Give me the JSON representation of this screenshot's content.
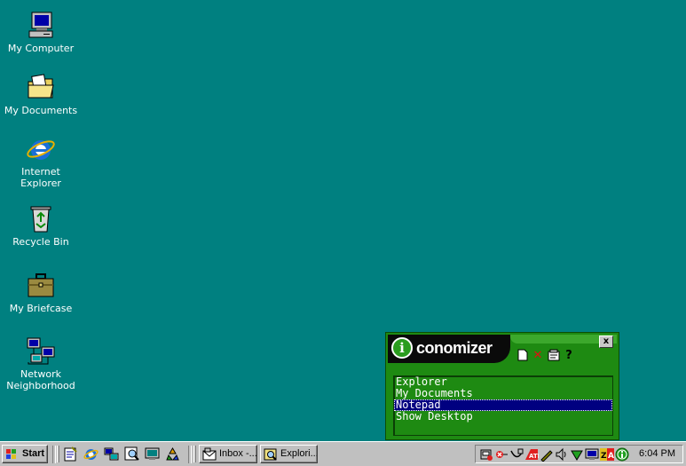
{
  "desktop": {
    "icons": [
      {
        "label": "My Computer",
        "icon": "my-computer-icon"
      },
      {
        "label": "My Documents",
        "icon": "my-documents-folder-icon"
      },
      {
        "label": "Internet Explorer",
        "icon": "internet-explorer-icon"
      },
      {
        "label": "Recycle Bin",
        "icon": "recycle-bin-icon"
      },
      {
        "label": "My Briefcase",
        "icon": "briefcase-icon"
      },
      {
        "label": "Network Neighborhood",
        "icon": "network-neighborhood-icon"
      }
    ],
    "background_color": "#008080"
  },
  "iconomizer": {
    "logo_letter": "i",
    "logo_text": "conomizer",
    "close_label": "x",
    "toolbar": [
      "new-icon",
      "delete-icon",
      "properties-icon",
      "help-icon"
    ],
    "help_label": "?",
    "items": [
      {
        "label": "Explorer",
        "selected": false
      },
      {
        "label": "My Documents",
        "selected": false
      },
      {
        "label": "Notepad",
        "selected": true
      },
      {
        "label": "Show Desktop",
        "selected": false
      }
    ],
    "accent_color": "#1e8a12"
  },
  "taskbar": {
    "start_label": "Start",
    "quick_launch": [
      "notepad-icon",
      "internet-explorer-icon",
      "network-icon",
      "find-icon",
      "display-icon",
      "recycle-icon"
    ],
    "tasks": [
      {
        "label": "Inbox -...",
        "icon": "inbox-icon"
      },
      {
        "label": "Explori...",
        "icon": "explorer-search-icon"
      }
    ],
    "tray_icons": [
      "volume-icon",
      "disconnect-icon",
      "network-tray-icon",
      "ati-icon",
      "pen-icon",
      "speaker-icon",
      "antivirus-icon",
      "monitor-icon",
      "zonealarm-icon",
      "info-icon"
    ],
    "clock": "6:04 PM"
  }
}
